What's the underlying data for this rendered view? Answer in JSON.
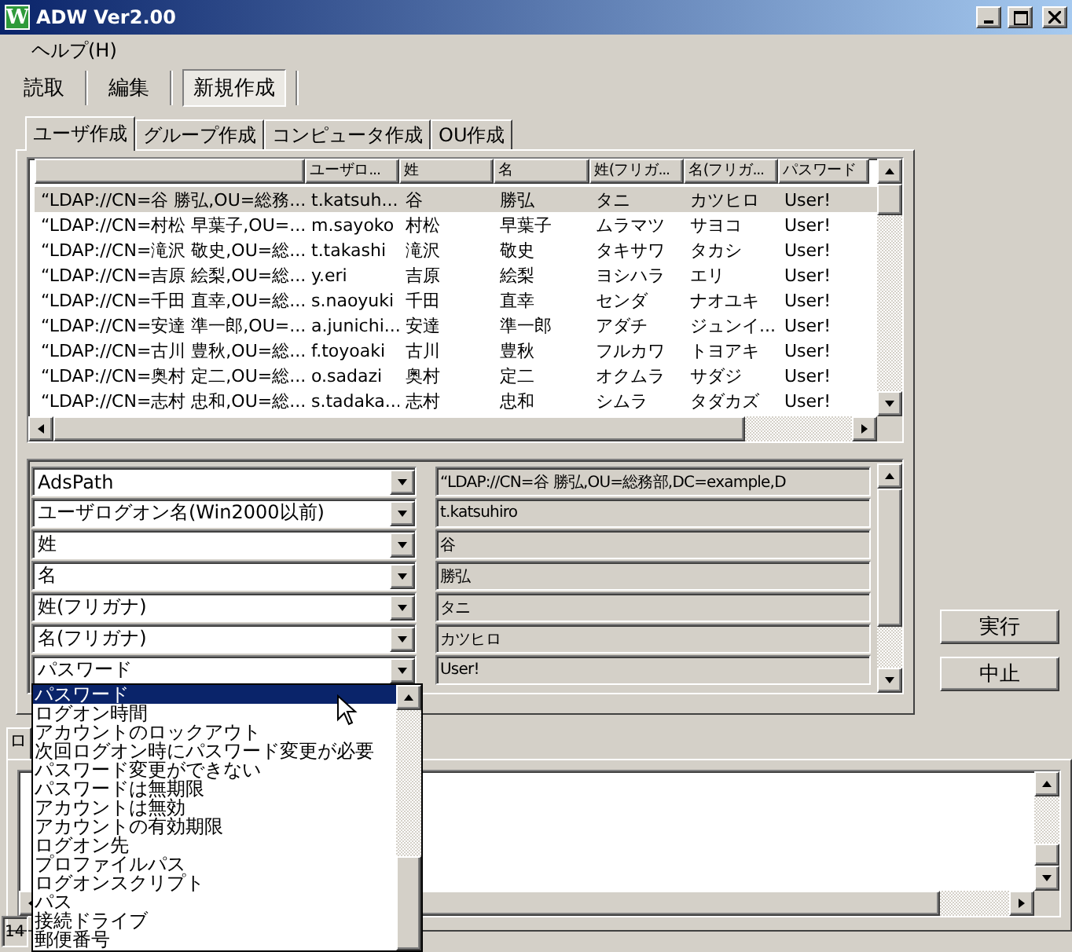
{
  "window": {
    "title": "ADW Ver2.00",
    "icon_letter": "W"
  },
  "menu": [
    {
      "label": "ヘルプ(H)"
    }
  ],
  "toolbar": [
    {
      "label": "読取",
      "selected": false
    },
    {
      "label": "編集",
      "selected": false
    },
    {
      "label": "新規作成",
      "selected": true
    }
  ],
  "tabs": [
    {
      "label": "ユーザ作成",
      "selected": true
    },
    {
      "label": "グループ作成",
      "selected": false
    },
    {
      "label": "コンピュータ作成",
      "selected": false
    },
    {
      "label": "OU作成",
      "selected": false
    }
  ],
  "table": {
    "columns": [
      "",
      "ユーザロ...",
      "姓",
      "名",
      "姓(フリガ...",
      "名(フリガ...",
      "パスワード"
    ],
    "rows": [
      {
        "selected": true,
        "cells": [
          "“LDAP://CN=谷 勝弘,OU=総務...",
          "t.katsuh...",
          "谷",
          "勝弘",
          "タニ",
          "カツヒロ",
          "User!"
        ]
      },
      {
        "selected": false,
        "cells": [
          "“LDAP://CN=村松 早葉子,OU=...",
          "m.sayoko",
          "村松",
          "早葉子",
          "ムラマツ",
          "サヨコ",
          "User!"
        ]
      },
      {
        "selected": false,
        "cells": [
          "“LDAP://CN=滝沢 敬史,OU=総...",
          "t.takashi",
          "滝沢",
          "敬史",
          "タキサワ",
          "タカシ",
          "User!"
        ]
      },
      {
        "selected": false,
        "cells": [
          "“LDAP://CN=吉原 絵梨,OU=総...",
          "y.eri",
          "吉原",
          "絵梨",
          "ヨシハラ",
          "エリ",
          "User!"
        ]
      },
      {
        "selected": false,
        "cells": [
          "“LDAP://CN=千田 直幸,OU=総...",
          "s.naoyuki",
          "千田",
          "直幸",
          "センダ",
          "ナオユキ",
          "User!"
        ]
      },
      {
        "selected": false,
        "cells": [
          "“LDAP://CN=安達 準一郎,OU=...",
          "a.junichi...",
          "安達",
          "準一郎",
          "アダチ",
          "ジュンイ...",
          "User!"
        ]
      },
      {
        "selected": false,
        "cells": [
          "“LDAP://CN=古川 豊秋,OU=総...",
          "f.toyoaki",
          "古川",
          "豊秋",
          "フルカワ",
          "トヨアキ",
          "User!"
        ]
      },
      {
        "selected": false,
        "cells": [
          "“LDAP://CN=奥村 定二,OU=総...",
          "o.sadazi",
          "奥村",
          "定二",
          "オクムラ",
          "サダジ",
          "User!"
        ]
      },
      {
        "selected": false,
        "cells": [
          "“LDAP://CN=志村 忠和,OU=総...",
          "s.tadaka...",
          "志村",
          "忠和",
          "シムラ",
          "タダカズ",
          "User!"
        ]
      }
    ]
  },
  "properties": [
    {
      "field": "AdsPath",
      "value": "“LDAP://CN=谷 勝弘,OU=総務部,DC=example,D"
    },
    {
      "field": "ユーザログオン名(Win2000以前)",
      "value": "t.katsuhiro"
    },
    {
      "field": "姓",
      "value": "谷"
    },
    {
      "field": "名",
      "value": "勝弘"
    },
    {
      "field": "姓(フリガナ)",
      "value": "タニ"
    },
    {
      "field": "名(フリガナ)",
      "value": "カツヒロ"
    },
    {
      "field": "パスワード",
      "value": "User!"
    }
  ],
  "dropdown": {
    "items": [
      {
        "label": "パスワード",
        "selected": true
      },
      {
        "label": "ログオン時間",
        "selected": false
      },
      {
        "label": "アカウントのロックアウト",
        "selected": false
      },
      {
        "label": "次回ログオン時にパスワード変更が必要",
        "selected": false
      },
      {
        "label": "パスワード変更ができない",
        "selected": false
      },
      {
        "label": "パスワードは無期限",
        "selected": false
      },
      {
        "label": "アカウントは無効",
        "selected": false
      },
      {
        "label": "アカウントの有効期限",
        "selected": false
      },
      {
        "label": "ログオン先",
        "selected": false
      },
      {
        "label": "プロファイルパス",
        "selected": false
      },
      {
        "label": "ログオンスクリプト",
        "selected": false
      },
      {
        "label": "パス",
        "selected": false
      },
      {
        "label": "接続ドライブ",
        "selected": false
      },
      {
        "label": "郵便番号",
        "selected": false
      }
    ]
  },
  "buttons": [
    "実行",
    "中止"
  ],
  "bottom_tab": "ロ",
  "status_bar": "14"
}
